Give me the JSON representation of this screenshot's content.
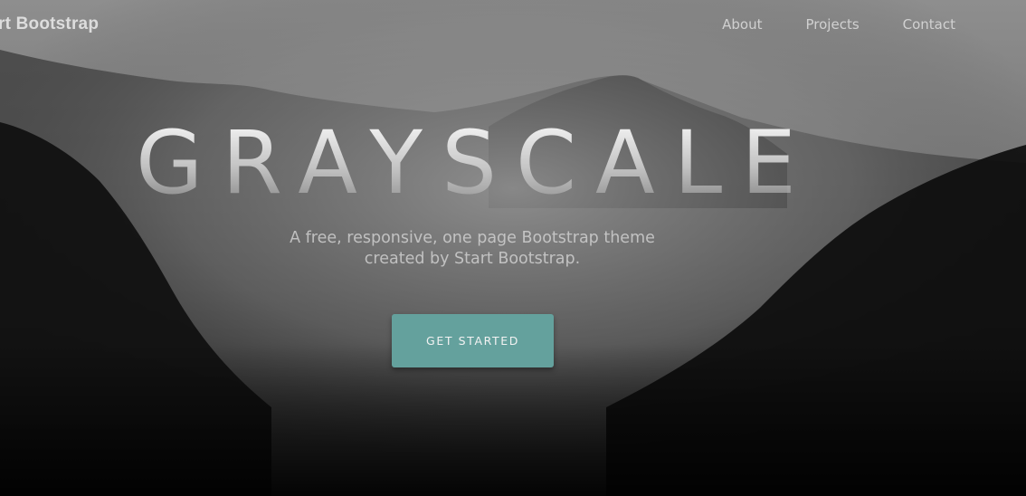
{
  "navbar": {
    "brand": "rt Bootstrap",
    "links": [
      "About",
      "Projects",
      "Contact"
    ]
  },
  "hero": {
    "title": "GRAYSCALE",
    "subtitle_line1": "A free, responsive, one page Bootstrap theme",
    "subtitle_line2": "created by Start Bootstrap.",
    "cta_label": "GET STARTED"
  },
  "colors": {
    "accent": "#64a19d",
    "nav_text": "#e6e6e6",
    "background_dark": "#000000"
  }
}
